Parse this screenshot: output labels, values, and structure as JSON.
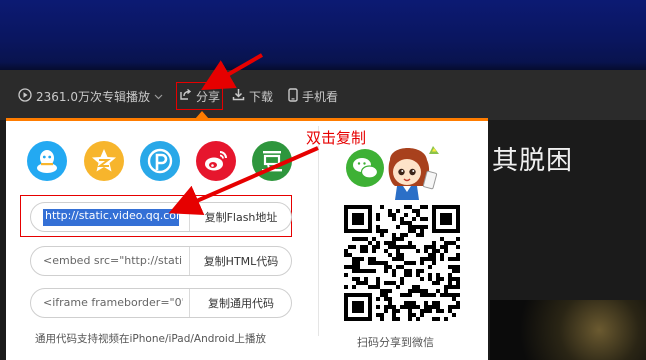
{
  "toolbar": {
    "plays_label": "2361.0万次专辑播放",
    "share_label": "分享",
    "download_label": "下载",
    "mobile_label": "手机看"
  },
  "background": {
    "title_fragment": "其脱困"
  },
  "share_panel": {
    "social_icons": [
      "qq-icon",
      "qzone-icon",
      "pengyou-icon",
      "weibo-icon",
      "douban-icon"
    ],
    "flash_field": {
      "value": "http://static.video.qq.com",
      "button_label": "复制Flash地址"
    },
    "html_field": {
      "value": "<embed src=\"http://stati",
      "button_label": "复制HTML代码"
    },
    "iframe_field": {
      "value": "<iframe frameborder=\"0\"",
      "button_label": "复制通用代码"
    },
    "hint": "通用代码支持视频在iPhone/iPad/Android上播放",
    "qr_caption": "扫码分享到微信"
  },
  "annotation": {
    "text": "双击复制"
  },
  "colors": {
    "accent": "#ff7c00",
    "annotation": "#e60000",
    "qq": "#23a9f2",
    "qzone": "#f7b52c",
    "pengyou": "#29a8e8",
    "weibo": "#e6162d",
    "douban": "#2e963d",
    "wechat": "#3eb135"
  }
}
